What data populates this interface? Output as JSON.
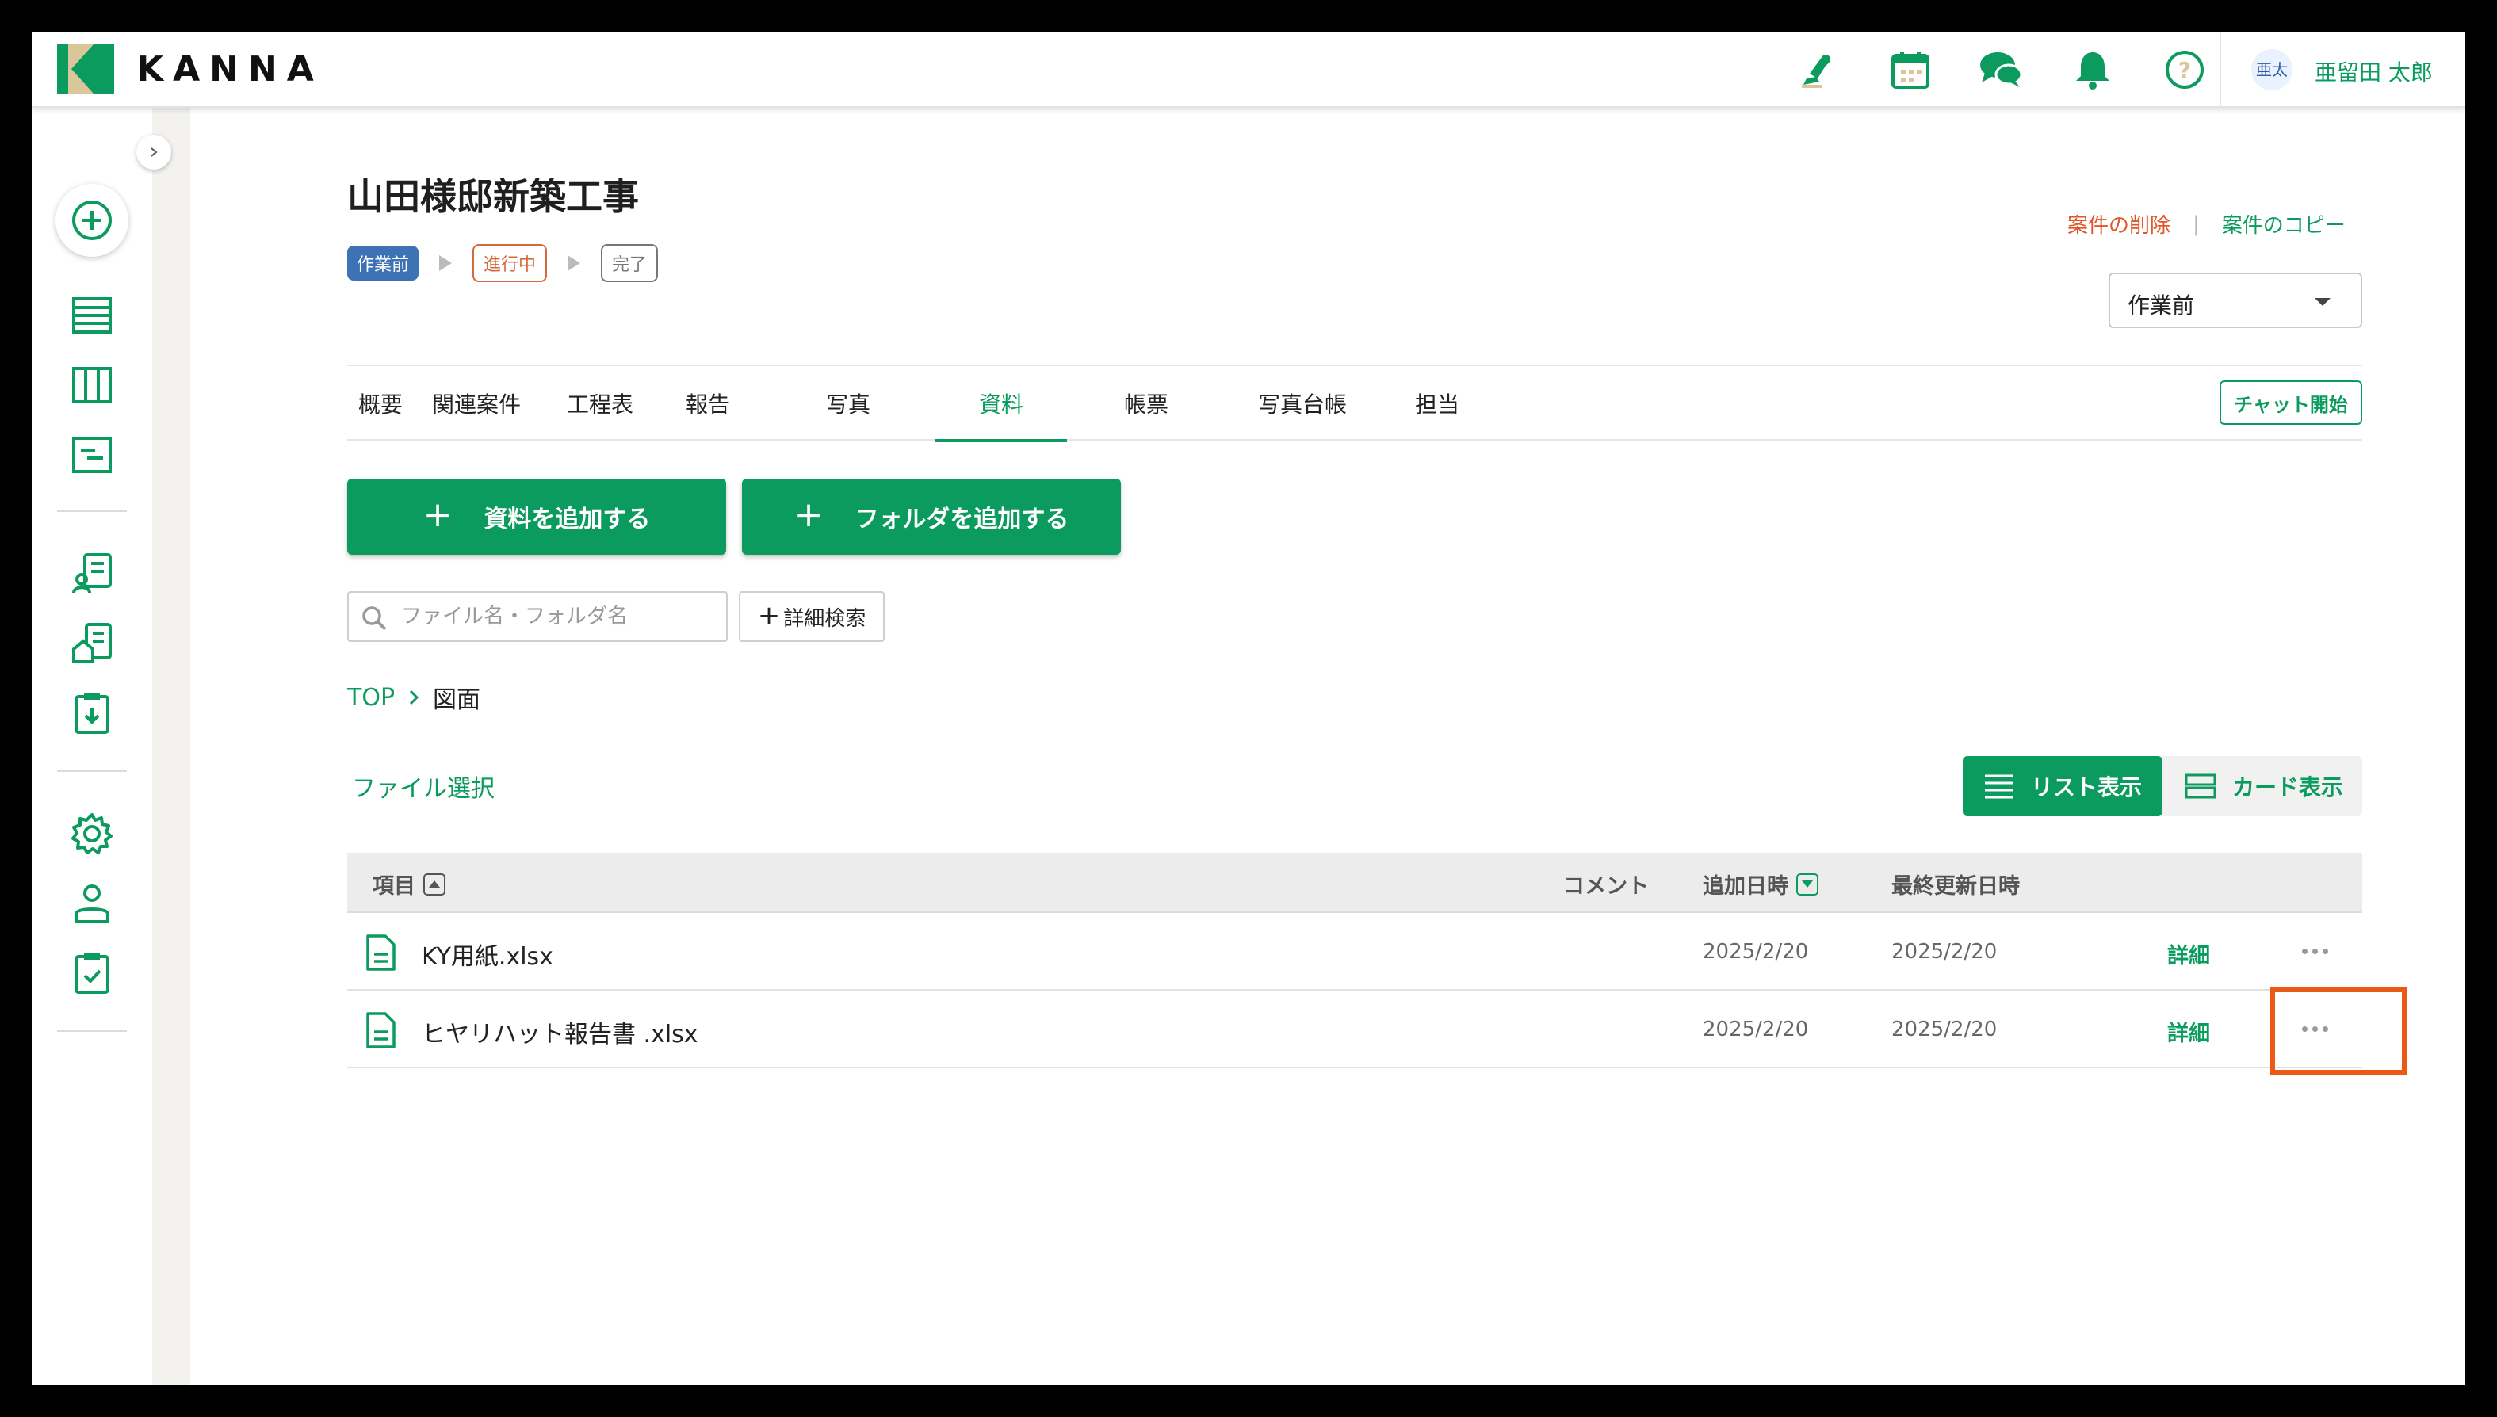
{
  "app": {
    "name": "KANNA"
  },
  "header": {
    "icons": [
      "stamp-icon",
      "calendar-icon",
      "chat-icon",
      "bell-icon",
      "help-icon"
    ],
    "user": {
      "avatar_text": "亜太",
      "name": "亜留田 太郎"
    }
  },
  "project": {
    "title": "山田様邸新築工事",
    "status_steps": [
      "作業前",
      "進行中",
      "完了"
    ],
    "delete_label": "案件の削除",
    "copy_label": "案件のコピー",
    "status_select_value": "作業前"
  },
  "tabs": [
    {
      "label": "概要"
    },
    {
      "label": "関連案件"
    },
    {
      "label": "工程表"
    },
    {
      "label": "報告"
    },
    {
      "label": "写真"
    },
    {
      "label": "資料",
      "active": true
    },
    {
      "label": "帳票"
    },
    {
      "label": "写真台帳"
    },
    {
      "label": "担当"
    }
  ],
  "chat_start_label": "チャット開始",
  "actions": {
    "add_file_label": "資料を追加する",
    "add_folder_label": "フォルダを追加する"
  },
  "search": {
    "placeholder": "ファイル名・フォルダ名",
    "advanced_label": "詳細検索"
  },
  "breadcrumb": {
    "root": "TOP",
    "current": "図面"
  },
  "file_select_label": "ファイル選択",
  "view_toggle": {
    "list_label": "リスト表示",
    "card_label": "カード表示",
    "active": "list"
  },
  "table": {
    "headers": {
      "item": "項目",
      "comment": "コメント",
      "added": "追加日時",
      "updated": "最終更新日時"
    },
    "rows": [
      {
        "name": "KY用紙.xlsx",
        "comment": "",
        "added": "2025/2/20",
        "updated": "2025/2/20",
        "detail": "詳細"
      },
      {
        "name": "ヒヤリハット報告書 .xlsx",
        "comment": "",
        "added": "2025/2/20",
        "updated": "2025/2/20",
        "detail": "詳細"
      }
    ]
  },
  "colors": {
    "brand_green": "#0b9b5e",
    "status_pre": "#3d72b4",
    "status_progress": "#d46a3c",
    "danger": "#e0562a",
    "highlight": "#ea5a14"
  }
}
